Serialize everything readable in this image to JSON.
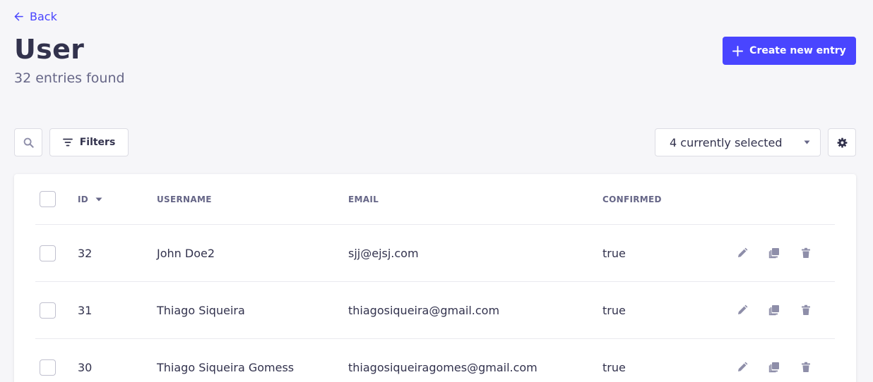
{
  "header": {
    "back_label": "Back",
    "title": "User",
    "subtitle": "32 entries found",
    "create_label": "Create new entry"
  },
  "toolbar": {
    "filters_label": "Filters",
    "columns_select_value": "4 currently selected"
  },
  "table": {
    "columns": [
      "ID",
      "USERNAME",
      "EMAIL",
      "CONFIRMED"
    ],
    "rows": [
      {
        "id": "32",
        "username": "John Doe2",
        "email": "sjj@ejsj.com",
        "confirmed": "true"
      },
      {
        "id": "31",
        "username": "Thiago Siqueira",
        "email": "thiagosiqueira@gmail.com",
        "confirmed": "true"
      },
      {
        "id": "30",
        "username": "Thiago Siqueira Gomess",
        "email": "thiagosiqueiragomes@gmail.com",
        "confirmed": "true"
      }
    ]
  },
  "icons": {
    "back": "arrow-left-icon",
    "create": "plus-icon",
    "search": "search-icon",
    "filters": "filter-icon",
    "select": "caret-down-icon",
    "settings": "gear-icon",
    "sort": "caret-down-icon",
    "edit": "pencil-icon",
    "duplicate": "duplicate-icon",
    "delete": "trash-icon"
  },
  "colors": {
    "primary": "#4945ff",
    "text": "#32324d",
    "muted": "#666687",
    "background": "#f6f6f9",
    "icon": "#8e8ea9"
  }
}
